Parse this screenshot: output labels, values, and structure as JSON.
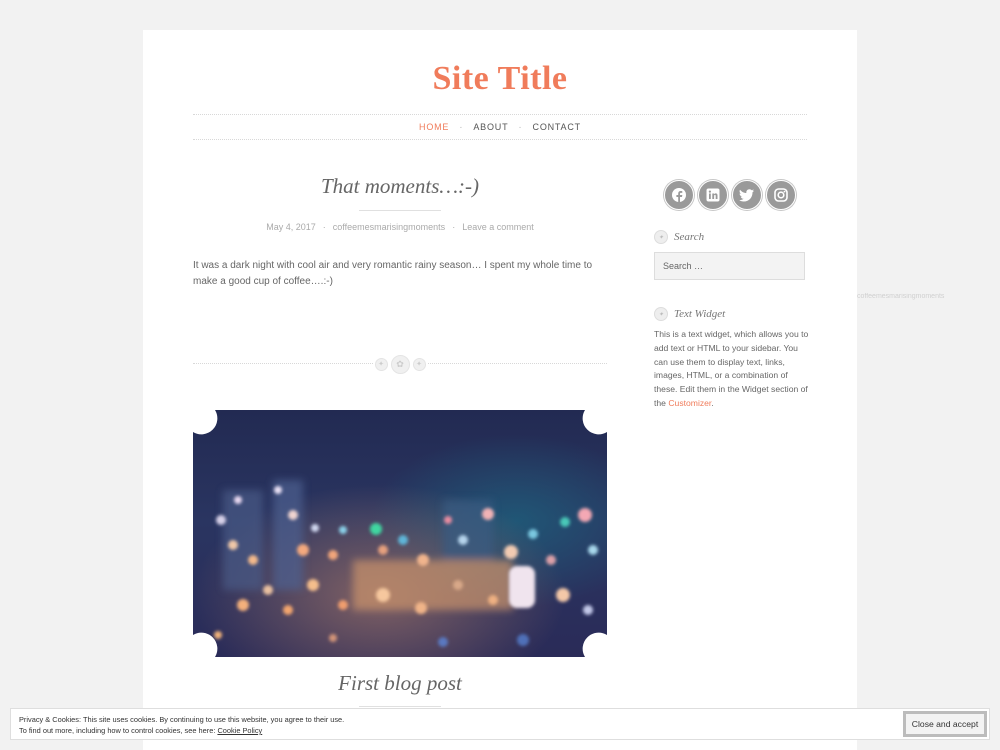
{
  "site": {
    "title": "Site Title"
  },
  "nav": {
    "home": "HOME",
    "about": "ABOUT",
    "contact": "CONTACT",
    "separator": "·"
  },
  "post": {
    "title": "That moments…:-)",
    "date": "May 4, 2017",
    "author": "coffeemesmarisingmoments",
    "comments": "Leave a comment",
    "separator": "·",
    "excerpt": "It was a dark night with cool air and very romantic rainy season… I spent my whole time to make a good cup of coffee….:-)"
  },
  "post2": {
    "title": "First blog post"
  },
  "sidebar": {
    "social_icons": [
      "facebook-icon",
      "linkedin-icon",
      "twitter-icon",
      "instagram-icon"
    ],
    "search": {
      "title": "Search",
      "placeholder": "Search …"
    },
    "text_widget": {
      "title": "Text Widget",
      "body": "This is a text widget, which allows you to add text or HTML to your sidebar. You can use them to display text, links, images, HTML, or a combination of these. Edit them in the Widget section of the ",
      "link": "Customizer",
      "end": "."
    }
  },
  "offscreen": {
    "text": "coffeemesmarisingmoments"
  },
  "cookie": {
    "line1": "Privacy & Cookies: This site uses cookies. By continuing to use this website, you agree to their use.",
    "line2": "To find out more, including how to control cookies, see here: ",
    "link": "Cookie Policy",
    "button": "Close and accept"
  },
  "colors": {
    "accent": "#f07c5b",
    "background": "#f2f2f2",
    "icon": "#9a9a9a"
  }
}
